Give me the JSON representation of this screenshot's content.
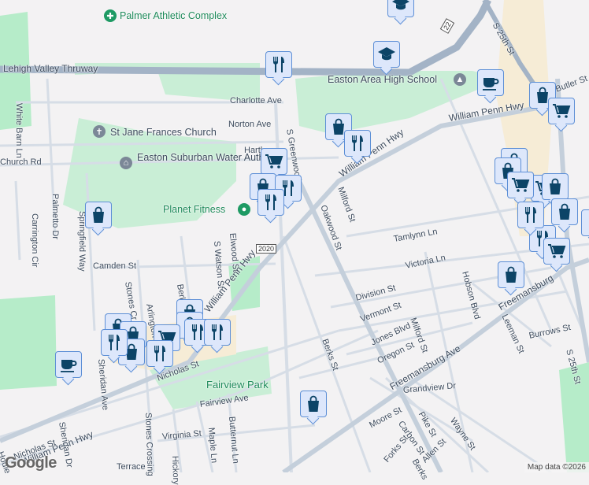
{
  "map": {
    "pois": {
      "palmer": "Palmer Athletic Complex",
      "high_school": "Easton Area High School",
      "church": "St Jane Frances Church",
      "water": "Easton Suburban Water Authority",
      "fitness": "Planet Fitness",
      "fairview": "Fairview Park"
    },
    "roads": [
      "Lehigh Valley Thruway",
      "Charlotte Ave",
      "Norton Ave",
      "Hartley",
      "S Greenwood",
      "William Penn Hwy",
      "William Penn Hwy",
      "White Barn Ln",
      "Church Rd",
      "Palmetto Dr",
      "Springfield Way",
      "Carrington Cir",
      "Camden St",
      "Stones Cr",
      "Arlington",
      "Berkley",
      "S Watson St",
      "Elwood St",
      "William Penn Hwy",
      "William Penn Hwy",
      "Nicholas St",
      "Nicholas St",
      "Sheridan Dr",
      "Stones Crossing",
      "Fairview Ave",
      "Virginia St",
      "Maple Ln",
      "Butternut Ln",
      "Hickory",
      "Terrace",
      "Milford St",
      "Oakwood St",
      "Tamlynn Ln",
      "Victoria Ln",
      "Division St",
      "Vermont St",
      "Jones Blvd",
      "Milford St",
      "Oregon St",
      "Berks St",
      "Freemansburg Ave",
      "Freemansburg",
      "Hobson Blvd",
      "Leeman St",
      "Burrows St",
      "S 25th St",
      "S 25th St",
      "Grandview Dr",
      "Moore St",
      "Pike St",
      "Carbon St",
      "Wayne St",
      "Forks St",
      "Allen St",
      "Berks",
      "Butler St",
      "Sheridan Ave",
      "Hodle"
    ],
    "route_shields": [
      "2020",
      "22"
    ],
    "google_logo": "Google",
    "attribution": "Map data ©2026"
  },
  "colors": {
    "park": "#b4ebc8",
    "highway": "#a3b3c6",
    "pin_fill": "#dde7fb",
    "pin_border": "#5d8fd6",
    "icon": "#0c4467"
  },
  "markers": [
    {
      "type": "restaurant"
    },
    {
      "type": "school"
    },
    {
      "type": "school"
    },
    {
      "type": "cafe"
    },
    {
      "type": "shopping"
    },
    {
      "type": "grocery"
    },
    {
      "type": "shopping"
    },
    {
      "type": "restaurant"
    },
    {
      "type": "grocery"
    },
    {
      "type": "shopping"
    },
    {
      "type": "restaurant"
    },
    {
      "type": "restaurant"
    },
    {
      "type": "shopping"
    },
    {
      "type": "shopping"
    },
    {
      "type": "shopping"
    },
    {
      "type": "grocery"
    },
    {
      "type": "shopping"
    },
    {
      "type": "shopping"
    },
    {
      "type": "grocery"
    },
    {
      "type": "shopping"
    },
    {
      "type": "shopping"
    },
    {
      "type": "restaurant"
    },
    {
      "type": "grocery"
    },
    {
      "type": "shopping"
    },
    {
      "type": "shopping"
    },
    {
      "type": "shopping"
    },
    {
      "type": "shopping"
    },
    {
      "type": "shopping"
    },
    {
      "type": "restaurant"
    },
    {
      "type": "restaurant"
    },
    {
      "type": "restaurant"
    },
    {
      "type": "grocery"
    },
    {
      "type": "restaurant"
    },
    {
      "type": "cafe"
    },
    {
      "type": "shopping"
    },
    {
      "type": "restaurant"
    }
  ]
}
